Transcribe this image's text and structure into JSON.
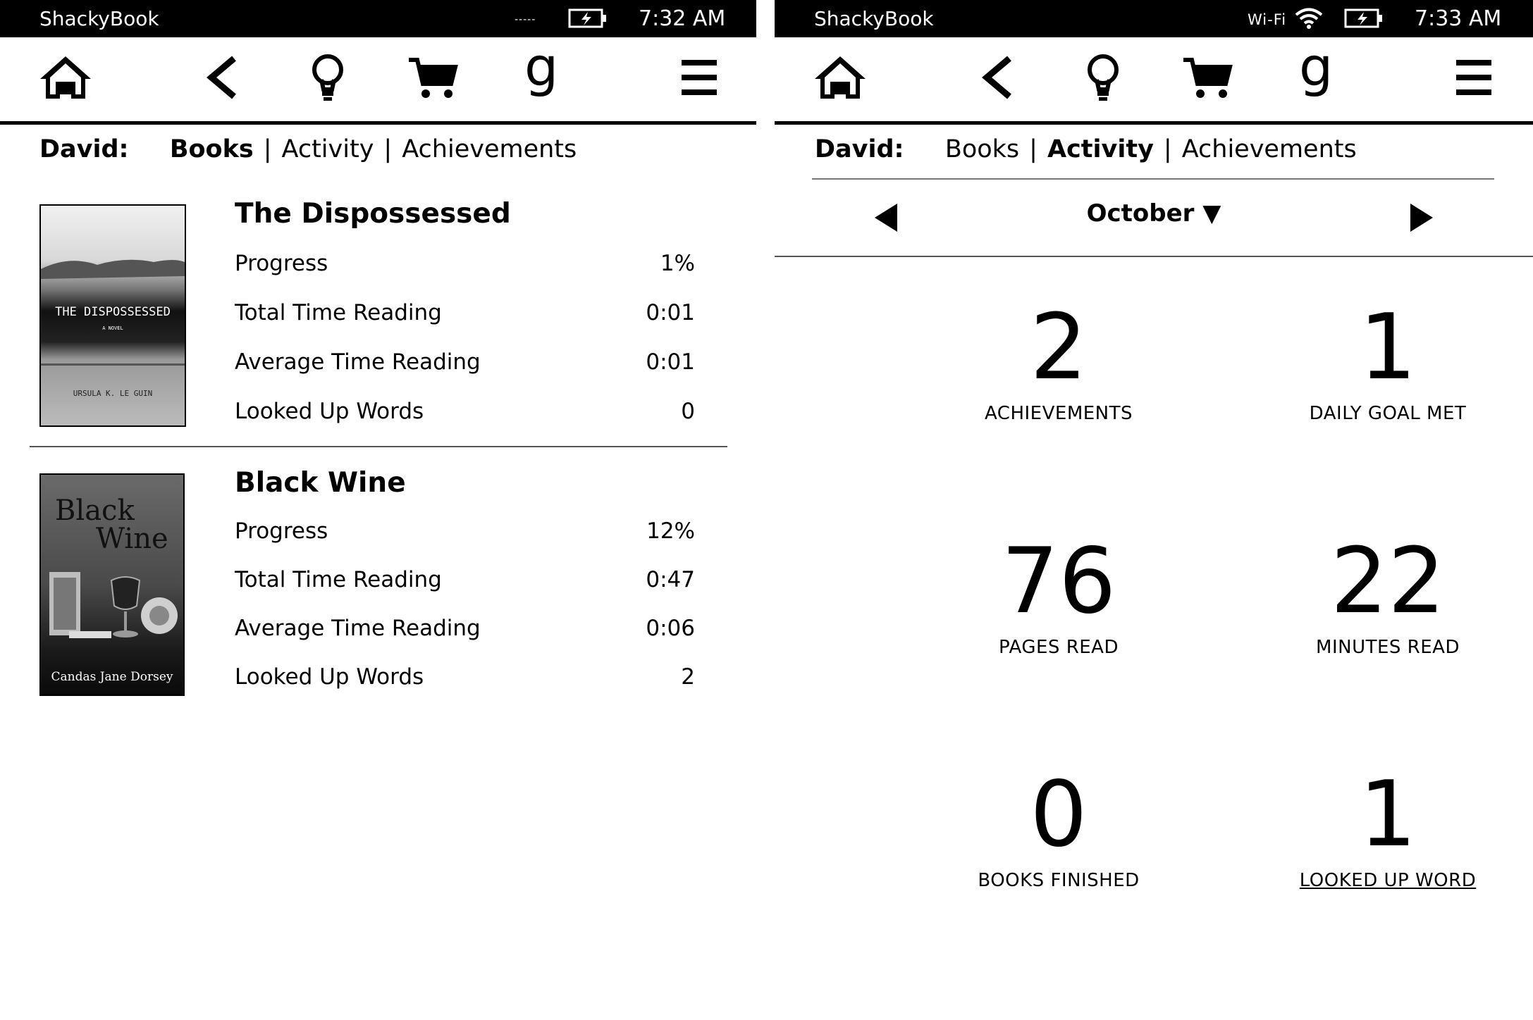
{
  "left": {
    "status": {
      "brand": "ShackyBook",
      "time": "7:32 AM",
      "wifi": "-----"
    },
    "nav": {
      "owner": "David:",
      "tabs": [
        "Books",
        "Activity",
        "Achievements"
      ],
      "active": "Books"
    },
    "books": [
      {
        "title": "The Dispossessed",
        "cover": {
          "title": "THE DISPOSSESSED",
          "subtitle": "A NOVEL",
          "author": "URSULA K. LE GUIN"
        },
        "stats": [
          {
            "label": "Progress",
            "value": "1%"
          },
          {
            "label": "Total Time Reading",
            "value": "0:01"
          },
          {
            "label": "Average Time Reading",
            "value": "0:01"
          },
          {
            "label": "Looked Up Words",
            "value": "0"
          }
        ]
      },
      {
        "title": "Black Wine",
        "cover": {
          "title_line1": "Black",
          "title_line2": "Wine",
          "author": "Candas Jane Dorsey"
        },
        "stats": [
          {
            "label": "Progress",
            "value": "12%"
          },
          {
            "label": "Total Time Reading",
            "value": "0:47"
          },
          {
            "label": "Average Time Reading",
            "value": "0:06"
          },
          {
            "label": "Looked Up Words",
            "value": "2"
          }
        ]
      }
    ]
  },
  "right": {
    "status": {
      "brand": "ShackyBook",
      "time": "7:33 AM",
      "wifi": "Wi-Fi"
    },
    "nav": {
      "owner": "David:",
      "tabs": [
        "Books",
        "Activity",
        "Achievements"
      ],
      "active": "Activity"
    },
    "month": "October ▼",
    "metrics": [
      {
        "value": "2",
        "label": "ACHIEVEMENTS"
      },
      {
        "value": "1",
        "label": "DAILY GOAL MET"
      },
      {
        "value": "76",
        "label": "PAGES READ"
      },
      {
        "value": "22",
        "label": "MINUTES READ"
      },
      {
        "value": "0",
        "label": "BOOKS FINISHED"
      },
      {
        "value": "1",
        "label": "LOOKED UP WORD"
      }
    ]
  },
  "icons": {
    "status": [
      "battery-charging-icon",
      "wifi-icon"
    ],
    "toolbar": [
      "home-icon",
      "back-icon",
      "lightbulb-icon",
      "cart-icon",
      "goodreads-icon",
      "menu-icon"
    ],
    "month": [
      "arrow-left-icon",
      "arrow-right-icon"
    ]
  }
}
